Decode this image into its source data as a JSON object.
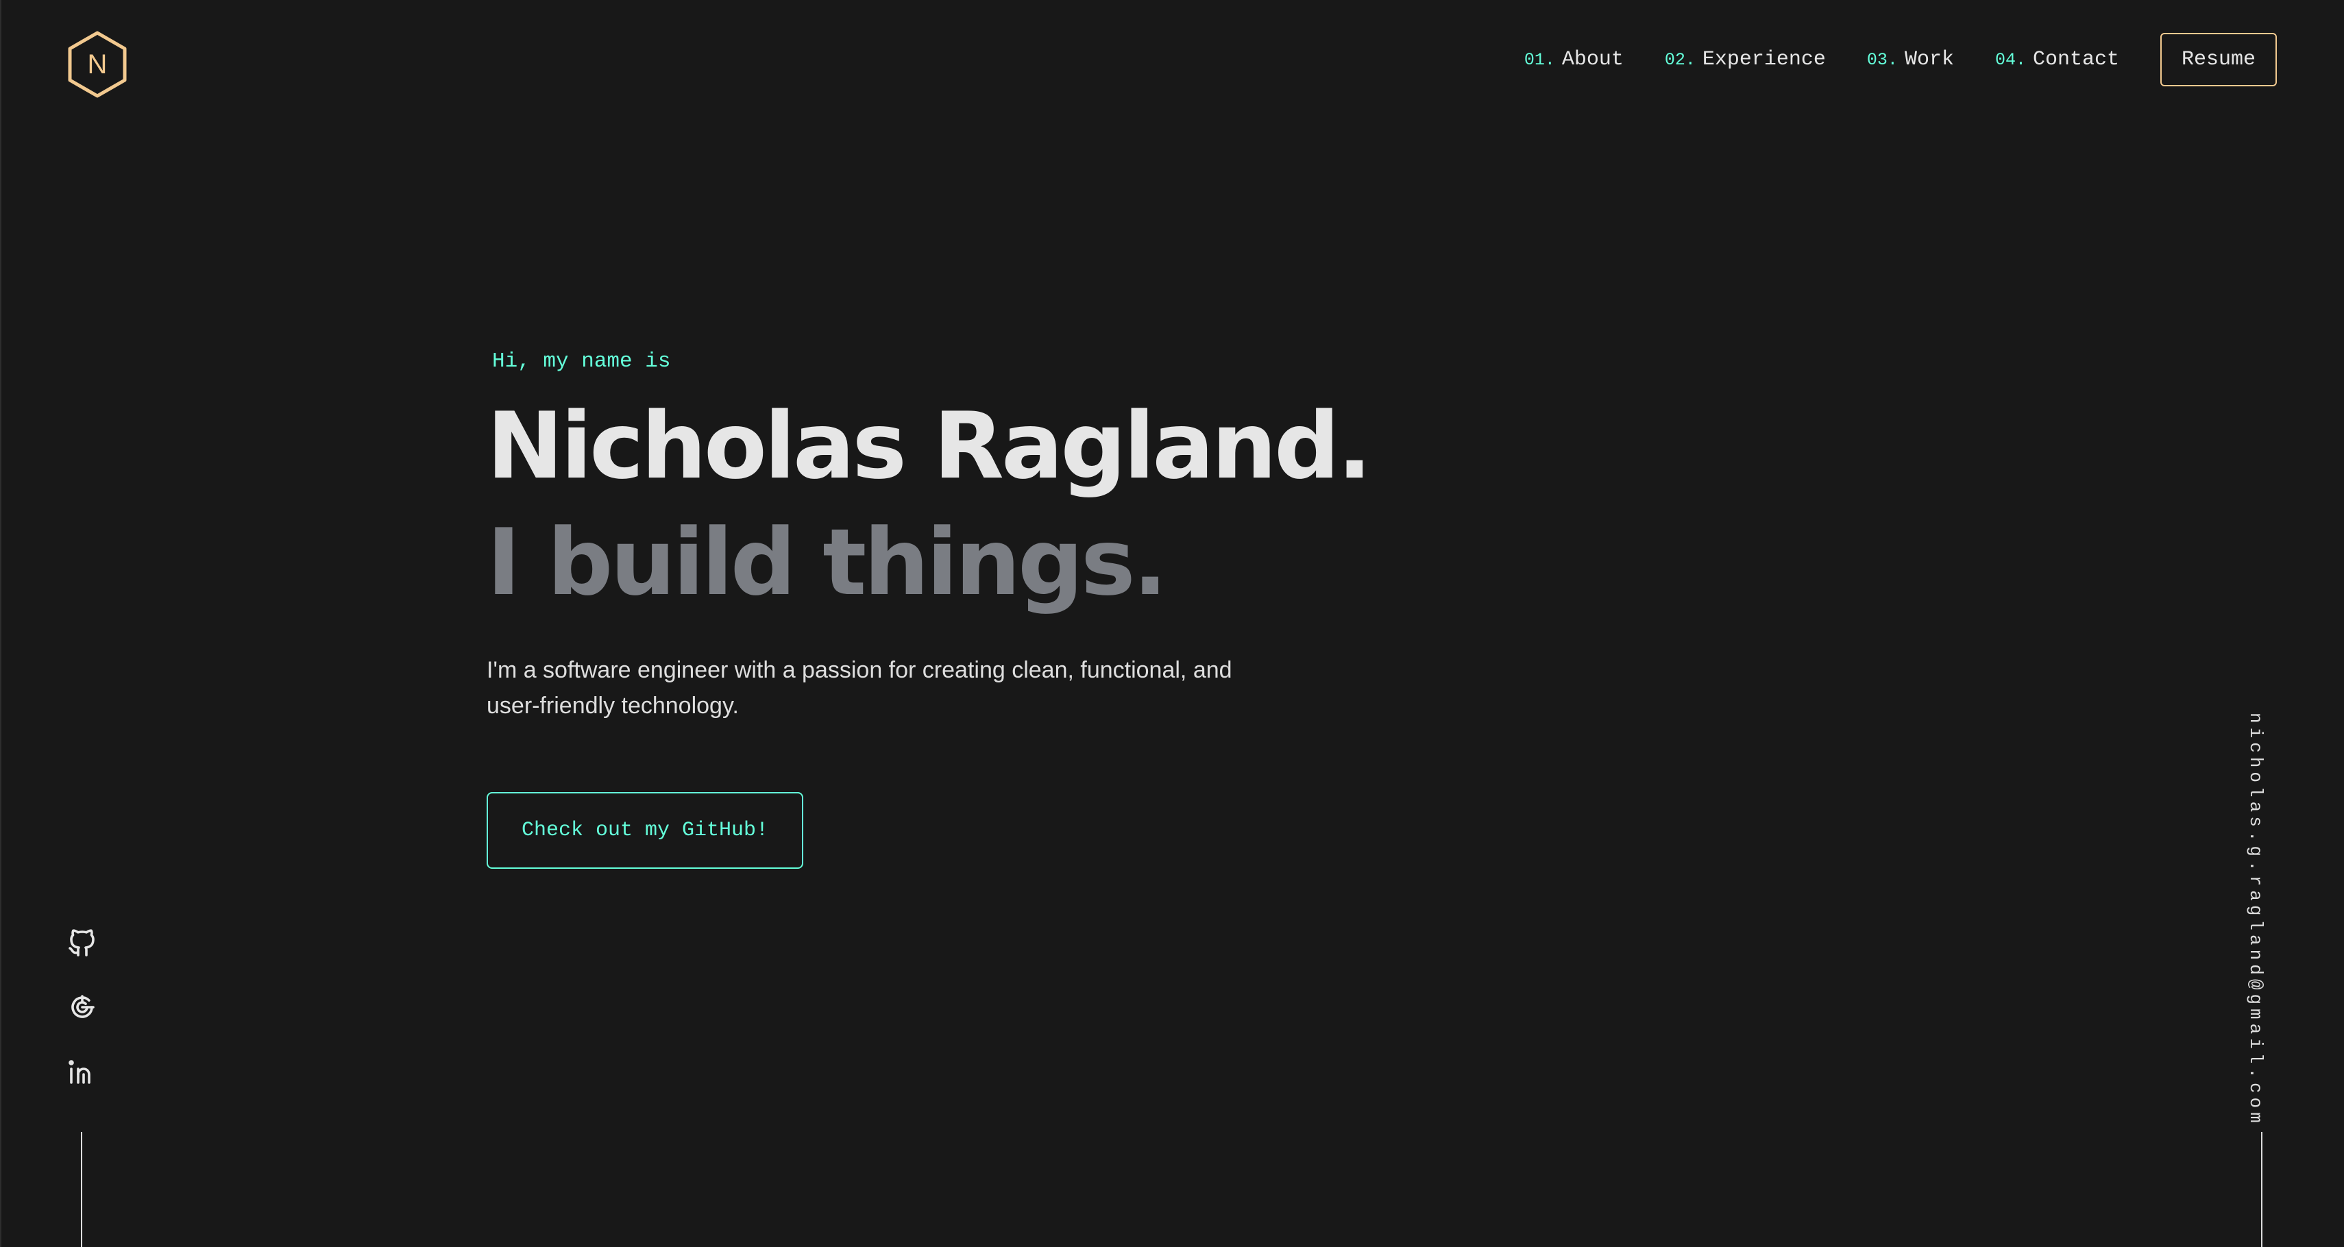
{
  "brand": {
    "logo_letter": "N",
    "logo_color": "#f2c98f"
  },
  "nav": {
    "items": [
      {
        "num": "01.",
        "label": "About"
      },
      {
        "num": "02.",
        "label": "Experience"
      },
      {
        "num": "03.",
        "label": "Work"
      },
      {
        "num": "04.",
        "label": "Contact"
      }
    ],
    "resume_label": "Resume"
  },
  "hero": {
    "greeting": "Hi, my name is",
    "name": "Nicholas Ragland.",
    "tagline": "I build things.",
    "intro": "I'm a software engineer with a passion for creating clean, functional, and user-friendly technology.",
    "cta_label": "Check out my GitHub!"
  },
  "social": {
    "icons": [
      "github-icon",
      "codepen-icon",
      "linkedin-icon"
    ]
  },
  "email": "nicholas.g.ragland@gmail.com",
  "colors": {
    "background": "#181818",
    "accent": "#64ffda",
    "gold": "#f2c98f",
    "text": "#e6e6e6",
    "muted": "#7a7d83"
  }
}
